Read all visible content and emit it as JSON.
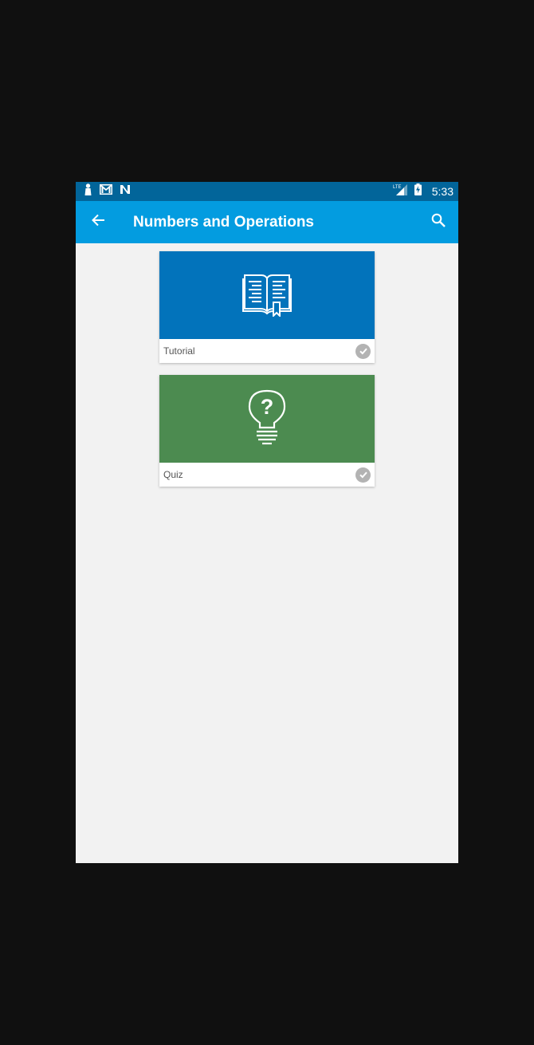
{
  "status_bar": {
    "time": "5:33",
    "network_label": "LTE",
    "icons": [
      "notification-person-icon",
      "gmail-icon",
      "n-app-icon",
      "lte-signal-icon",
      "battery-charging-icon"
    ]
  },
  "app_bar": {
    "title": "Numbers and Operations",
    "back_icon": "arrow-back-icon",
    "search_icon": "search-icon"
  },
  "cards": [
    {
      "label": "Tutorial",
      "icon": "book-icon",
      "color": "#0273bb",
      "completed": true
    },
    {
      "label": "Quiz",
      "icon": "lightbulb-question-icon",
      "color": "#4c8b50",
      "completed": true
    }
  ],
  "colors": {
    "status_bar": "#02659a",
    "app_bar": "#039ce0",
    "background": "#f2f2f2",
    "check": "#b3b3b3"
  }
}
